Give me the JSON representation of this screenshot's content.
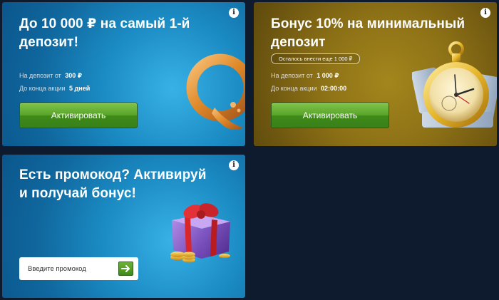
{
  "cards": {
    "qiwi": {
      "title": "До 10 000 ₽ на самый 1-й депозит!",
      "deposit_label": "На депозит от",
      "deposit_value": "300 ₽",
      "ends_label": "До конца акции",
      "ends_value": "5 дней",
      "button_label": "Активировать",
      "logo_icon": "qiwi-logo-icon",
      "info_glyph": "i"
    },
    "bonus10": {
      "title": "Бонус 10% на минимальный депозит",
      "pill_text": "Осталось внести еще 1 000 ₽",
      "deposit_label": "На депозит от",
      "deposit_value": "1 000 ₽",
      "ends_label": "До конца акции",
      "ends_value": "02:00:00",
      "button_label": "Активировать",
      "illustration_icon": "stopwatch-money-icon",
      "info_glyph": "i"
    },
    "promo": {
      "title": "Есть промокод? Активируй и получай бонус!",
      "input_placeholder": "Введите промокод",
      "input_value": "",
      "submit_icon": "arrow-right-icon",
      "illustration_icon": "gift-box-icon",
      "info_glyph": "i"
    }
  },
  "colors": {
    "page_bg": "#0e1b2e",
    "card_blue": "#1c96d2",
    "card_gold": "#8c7016",
    "button_green": "#5aa52a"
  }
}
